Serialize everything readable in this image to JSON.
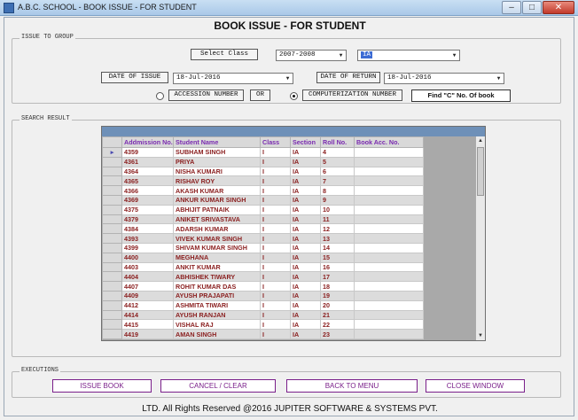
{
  "window": {
    "title": "A.B.C. SCHOOL - BOOK ISSUE - FOR STUDENT",
    "minimize": "–",
    "maximize": "□",
    "close": "✕"
  },
  "header": {
    "title": "BOOK ISSUE - FOR STUDENT"
  },
  "issue_group": {
    "label": "ISSUE TO GROUP",
    "select_class_label": "Select Class",
    "session_value": "2007-2008",
    "class_value": "IA",
    "date_of_issue_label": "DATE OF ISSUE",
    "date_of_issue_value": "18-Jul-2016",
    "date_of_return_label": "DATE OF RETURN",
    "date_of_return_value": "18-Jul-2016",
    "accession_label": "ACCESSION NUMBER",
    "or_label": "OR",
    "computerization_label": "COMPUTERIZATION NUMBER",
    "find_button": "Find \"C\" No. Of book"
  },
  "search_result": {
    "label": "SEARCH RESULT",
    "columns": [
      "Addmission No.",
      "Student Name",
      "Class",
      "Section",
      "Roll No.",
      "Book Acc. No."
    ],
    "rows": [
      [
        "4359",
        "SUBHAM SINGH",
        "I",
        "IA",
        "4",
        ""
      ],
      [
        "4361",
        "PRIYA",
        "I",
        "IA",
        "5",
        ""
      ],
      [
        "4364",
        "NISHA KUMARI",
        "I",
        "IA",
        "6",
        ""
      ],
      [
        "4365",
        "RISHAV ROY",
        "I",
        "IA",
        "7",
        ""
      ],
      [
        "4366",
        "AKASH KUMAR",
        "I",
        "IA",
        "8",
        ""
      ],
      [
        "4369",
        "ANKUR KUMAR SINGH",
        "I",
        "IA",
        "9",
        ""
      ],
      [
        "4375",
        "ABHIJIT PATNAIK",
        "I",
        "IA",
        "10",
        ""
      ],
      [
        "4379",
        "ANIKET SRIVASTAVA",
        "I",
        "IA",
        "11",
        ""
      ],
      [
        "4384",
        "ADARSH KUMAR",
        "I",
        "IA",
        "12",
        ""
      ],
      [
        "4393",
        "VIVEK KUMAR SINGH",
        "I",
        "IA",
        "13",
        ""
      ],
      [
        "4399",
        "SHIVAM KUMAR SINGH",
        "I",
        "IA",
        "14",
        ""
      ],
      [
        "4400",
        "MEGHANA",
        "I",
        "IA",
        "15",
        ""
      ],
      [
        "4403",
        "ANKIT KUMAR",
        "I",
        "IA",
        "16",
        ""
      ],
      [
        "4404",
        "ABHISHEK TIWARY",
        "I",
        "IA",
        "17",
        ""
      ],
      [
        "4407",
        "ROHIT KUMAR DAS",
        "I",
        "IA",
        "18",
        ""
      ],
      [
        "4409",
        "AYUSH PRAJAPATI",
        "I",
        "IA",
        "19",
        ""
      ],
      [
        "4412",
        "ASHMITA TIWARI",
        "I",
        "IA",
        "20",
        ""
      ],
      [
        "4414",
        "AYUSH RANJAN",
        "I",
        "IA",
        "21",
        ""
      ],
      [
        "4415",
        "VISHAL RAJ",
        "I",
        "IA",
        "22",
        ""
      ],
      [
        "4419",
        "AMAN SINGH",
        "I",
        "IA",
        "23",
        ""
      ]
    ]
  },
  "executions": {
    "label": "EXECUTIONS",
    "issue_book": "ISSUE BOOK",
    "cancel_clear": "CANCEL / CLEAR",
    "back_to_menu": "BACK TO MENU",
    "close_window": "CLOSE WINDOW"
  },
  "footer": {
    "text": "LTD. All Rights Reserved @2016 JUPITER SOFTWARE & SYSTEMS PVT."
  },
  "colors": {
    "accent": "#7a1f8a",
    "grid_text": "#8a1e1e",
    "header_text": "#7a2bb0",
    "grid_band": "#6e90b8"
  }
}
